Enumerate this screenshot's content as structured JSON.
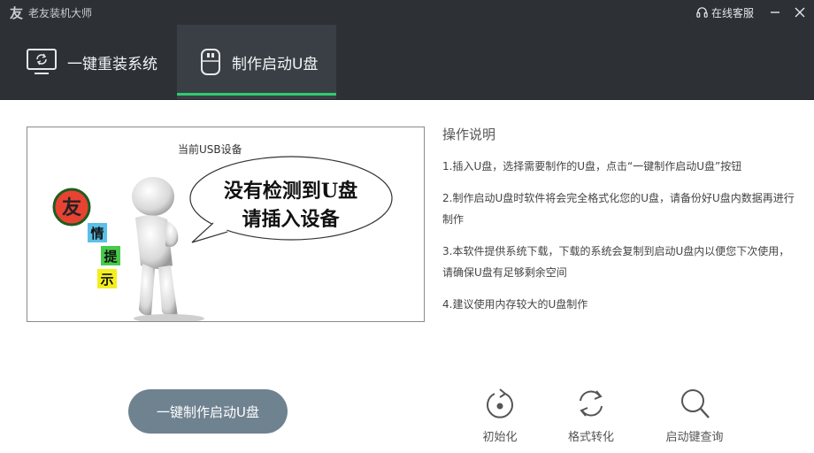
{
  "app": {
    "title": "老友装机大师",
    "service_label": "在线客服"
  },
  "tabs": [
    {
      "label": "一键重装系统",
      "icon": "monitor-refresh-icon",
      "active": false
    },
    {
      "label": "制作启动U盘",
      "icon": "usb-drive-icon",
      "active": true
    }
  ],
  "picture": {
    "device_label": "当前USB设备",
    "bubble_line1": "没有检测到U盘",
    "bubble_line2": "请插入设备",
    "badge_char": "友",
    "tip_chars": [
      "情",
      "提",
      "示"
    ]
  },
  "instructions": {
    "title": "操作说明",
    "steps": [
      "1.插入U盘，选择需要制作的U盘，点击“一键制作启动U盘”按钮",
      "2.制作启动U盘时软件将会完全格式化您的U盘，请备份好U盘内数据再进行制作",
      "3.本软件提供系统下载，下载的系统会复制到启动U盘内以便您下次使用，请确保U盘有足够剩余空间",
      "4.建议使用内存较大的U盘制作"
    ]
  },
  "actions": {
    "make_button": "一键制作启动U盘"
  },
  "tools": [
    {
      "label": "初始化",
      "icon": "reset-icon"
    },
    {
      "label": "格式转化",
      "icon": "convert-icon"
    },
    {
      "label": "启动键查询",
      "icon": "search-icon"
    }
  ],
  "colors": {
    "titlebar": "#2d3136",
    "active_tab": "#3a3f45",
    "accent_green": "#2ecc71",
    "button": "#6f8290"
  }
}
